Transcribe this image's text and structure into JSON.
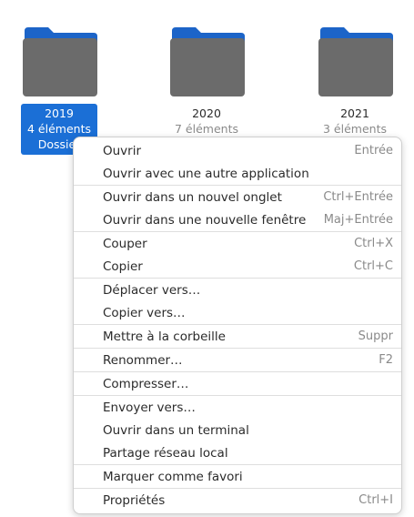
{
  "folders": [
    {
      "name": "2019",
      "count": "4 éléments",
      "type": "Dossier",
      "selected": true
    },
    {
      "name": "2020",
      "count": "7 éléments",
      "selected": false
    },
    {
      "name": "2021",
      "count": "3 éléments",
      "selected": false
    }
  ],
  "colors": {
    "folder_tab": "#1c64c8",
    "folder_body": "#6b6b6b",
    "selection": "#1b6fd6"
  },
  "context_menu": {
    "groups": [
      {
        "items": [
          {
            "label": "Ouvrir",
            "shortcut": "Entrée"
          },
          {
            "label": "Ouvrir avec une autre application",
            "shortcut": ""
          }
        ]
      },
      {
        "items": [
          {
            "label": "Ouvrir dans un nouvel onglet",
            "shortcut": "Ctrl+Entrée"
          },
          {
            "label": "Ouvrir dans une nouvelle fenêtre",
            "shortcut": "Maj+Entrée"
          }
        ]
      },
      {
        "items": [
          {
            "label": "Couper",
            "shortcut": "Ctrl+X"
          },
          {
            "label": "Copier",
            "shortcut": "Ctrl+C"
          }
        ]
      },
      {
        "items": [
          {
            "label": "Déplacer vers…",
            "shortcut": ""
          },
          {
            "label": "Copier vers…",
            "shortcut": ""
          }
        ]
      },
      {
        "items": [
          {
            "label": "Mettre à la corbeille",
            "shortcut": "Suppr"
          }
        ]
      },
      {
        "items": [
          {
            "label": "Renommer…",
            "shortcut": "F2"
          }
        ]
      },
      {
        "items": [
          {
            "label": "Compresser…",
            "shortcut": ""
          }
        ]
      },
      {
        "items": [
          {
            "label": "Envoyer vers…",
            "shortcut": ""
          },
          {
            "label": "Ouvrir dans un terminal",
            "shortcut": ""
          },
          {
            "label": "Partage réseau local",
            "shortcut": ""
          }
        ]
      },
      {
        "items": [
          {
            "label": "Marquer comme favori",
            "shortcut": ""
          }
        ]
      },
      {
        "items": [
          {
            "label": "Propriétés",
            "shortcut": "Ctrl+I"
          }
        ]
      }
    ]
  }
}
